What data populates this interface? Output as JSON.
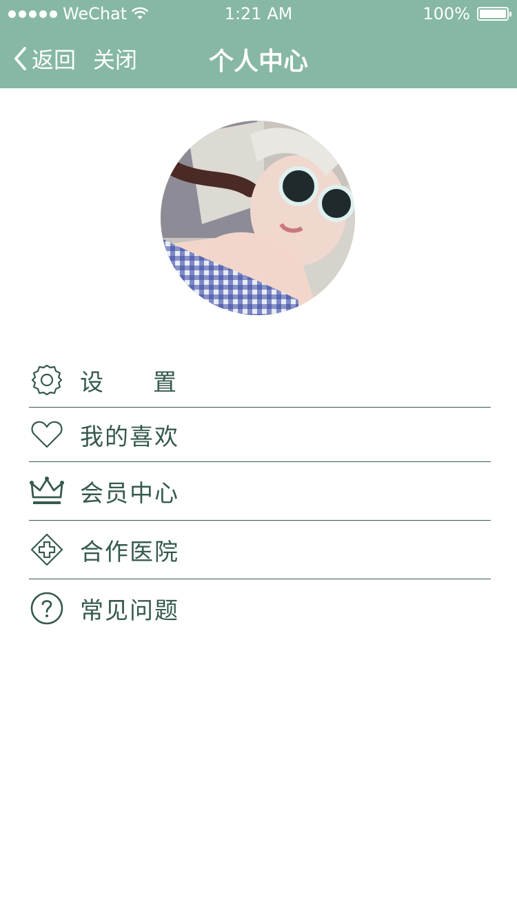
{
  "status_bar": {
    "carrier": "WeChat",
    "time": "1:21 AM",
    "battery": "100%",
    "battery_level": 1.0
  },
  "nav": {
    "back_label": "返回",
    "close_label": "关闭",
    "title": "个人中心"
  },
  "colors": {
    "header_bg": "#86b8a3",
    "accent": "#355a4c"
  },
  "menu": [
    {
      "icon": "gear-icon",
      "label": "设置"
    },
    {
      "icon": "heart-icon",
      "label": "我的喜欢"
    },
    {
      "icon": "crown-icon",
      "label": "会员中心"
    },
    {
      "icon": "hospital-cross-icon",
      "label": "合作医院"
    },
    {
      "icon": "question-icon",
      "label": "常见问题"
    }
  ]
}
